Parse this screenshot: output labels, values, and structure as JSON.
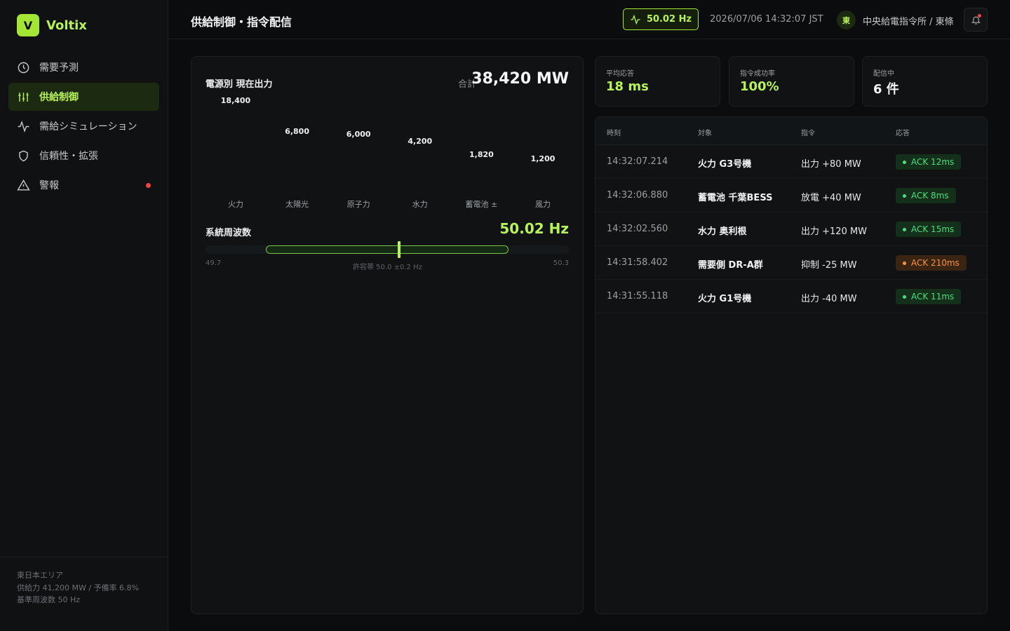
{
  "brand": {
    "mark": "V",
    "name": "Voltix"
  },
  "nav": [
    {
      "label": "需要予測",
      "icon": "clock-icon"
    },
    {
      "label": "供給制御",
      "icon": "sliders-icon",
      "active": true
    },
    {
      "label": "需給シミュレーション",
      "icon": "activity-icon"
    },
    {
      "label": "信頼性・拡張",
      "icon": "shield-icon"
    },
    {
      "label": "警報",
      "icon": "warning-icon",
      "alert": true
    }
  ],
  "footer": {
    "line1": "東日本エリア",
    "line2": "供給力 41,200 MW / 予備率 6.8%",
    "line3": "基準周波数 50 Hz"
  },
  "header": {
    "title": "供給制御・指令配信",
    "freq_chip": "50.02 Hz",
    "datetime": "2026/07/06 14:32:07 JST",
    "avatar": "東",
    "office": "中央給電指令所 / 東條"
  },
  "output": {
    "title": "電源別 現在出力",
    "total_label": "合計",
    "total_value": "38,420 MW"
  },
  "chart_data": {
    "type": "bar",
    "title": "電源別 現在出力",
    "categories": [
      "火力",
      "太陽光",
      "原子力",
      "水力",
      "蓄電池 ±",
      "風力"
    ],
    "values": [
      18400,
      6800,
      6000,
      4200,
      1820,
      1200
    ],
    "value_labels": [
      "18,400",
      "6,800",
      "6,000",
      "4,200",
      "1,820",
      "1,200"
    ],
    "unit": "MW"
  },
  "frequency": {
    "title": "系統周波数",
    "value_text": "50.02 Hz",
    "value": 50.02,
    "min": 49.7,
    "max": 50.3,
    "min_label": "49.7",
    "max_label": "50.3",
    "band_low": 49.8,
    "band_high": 50.2,
    "band_label": "許容帯 50.0 ±0.2 Hz"
  },
  "kpis": [
    {
      "label": "平均応答",
      "value": "18 ms",
      "color": "#b7f25a"
    },
    {
      "label": "指令成功率",
      "value": "100%",
      "color": "#b7f25a"
    },
    {
      "label": "配信中",
      "value": "6 件",
      "color": "#f3f4f5"
    }
  ],
  "dispatch": {
    "headers": [
      "時刻",
      "対象",
      "指令",
      "応答"
    ],
    "rows": [
      {
        "time": "14:32:07.214",
        "target": "火力 G3号機",
        "command": "出力 +80 MW",
        "ack": "ACK 12ms",
        "status": "ok"
      },
      {
        "time": "14:32:06.880",
        "target": "蓄電池 千葉BESS",
        "command": "放電 +40 MW",
        "ack": "ACK 8ms",
        "status": "ok"
      },
      {
        "time": "14:32:02.560",
        "target": "水力 奥利根",
        "command": "出力 +120 MW",
        "ack": "ACK 15ms",
        "status": "ok"
      },
      {
        "time": "14:31:58.402",
        "target": "需要側 DR-A群",
        "command": "抑制 -25 MW",
        "ack": "ACK 210ms",
        "status": "warn"
      },
      {
        "time": "14:31:55.118",
        "target": "火力 G1号機",
        "command": "出力 -40 MW",
        "ack": "ACK 11ms",
        "status": "ok"
      }
    ]
  }
}
